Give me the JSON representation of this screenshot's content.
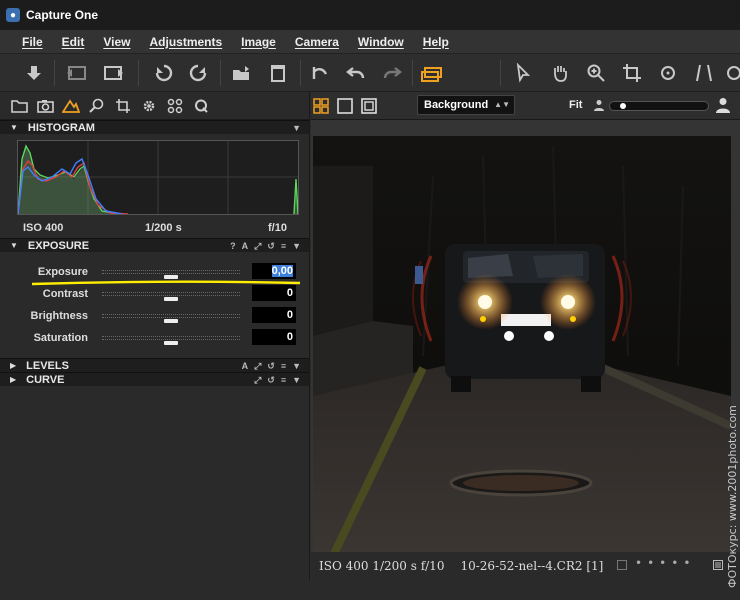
{
  "window": {
    "title": "Capture One"
  },
  "menu": [
    "File",
    "Edit",
    "View",
    "Adjustments",
    "Image",
    "Camera",
    "Window",
    "Help"
  ],
  "toolbar": {
    "icons": [
      "import-icon",
      "rotate-ccw-icon",
      "rotate-cw-icon",
      "trash-icon"
    ]
  },
  "histogram": {
    "title": "HISTOGRAM",
    "iso": "ISO 400",
    "shutter": "1/200 s",
    "aperture": "f/10"
  },
  "exposure": {
    "title": "EXPOSURE",
    "controls": [
      "?",
      "A"
    ],
    "sliders": [
      {
        "label": "Exposure",
        "value": "0,00",
        "position": 0.5
      },
      {
        "label": "Contrast",
        "value": "0",
        "position": 0.5
      },
      {
        "label": "Brightness",
        "value": "0",
        "position": 0.5
      },
      {
        "label": "Saturation",
        "value": "0",
        "position": 0.5
      }
    ]
  },
  "levels": {
    "title": "LEVELS",
    "controls": [
      "A"
    ]
  },
  "curve": {
    "title": "CURVE"
  },
  "viewer": {
    "style": "Background",
    "zoom": "Fit"
  },
  "photo_info": {
    "meta": "ISO 400  1/200 s f/10",
    "filename": "10-26-52-nel--4.CR2 [1]"
  },
  "watermark": "ФОТОкурс: www.2001photo.com",
  "colors": {
    "accent": "#f0a020",
    "highlight": "#ffee00",
    "selection": "#3d7fd9"
  }
}
